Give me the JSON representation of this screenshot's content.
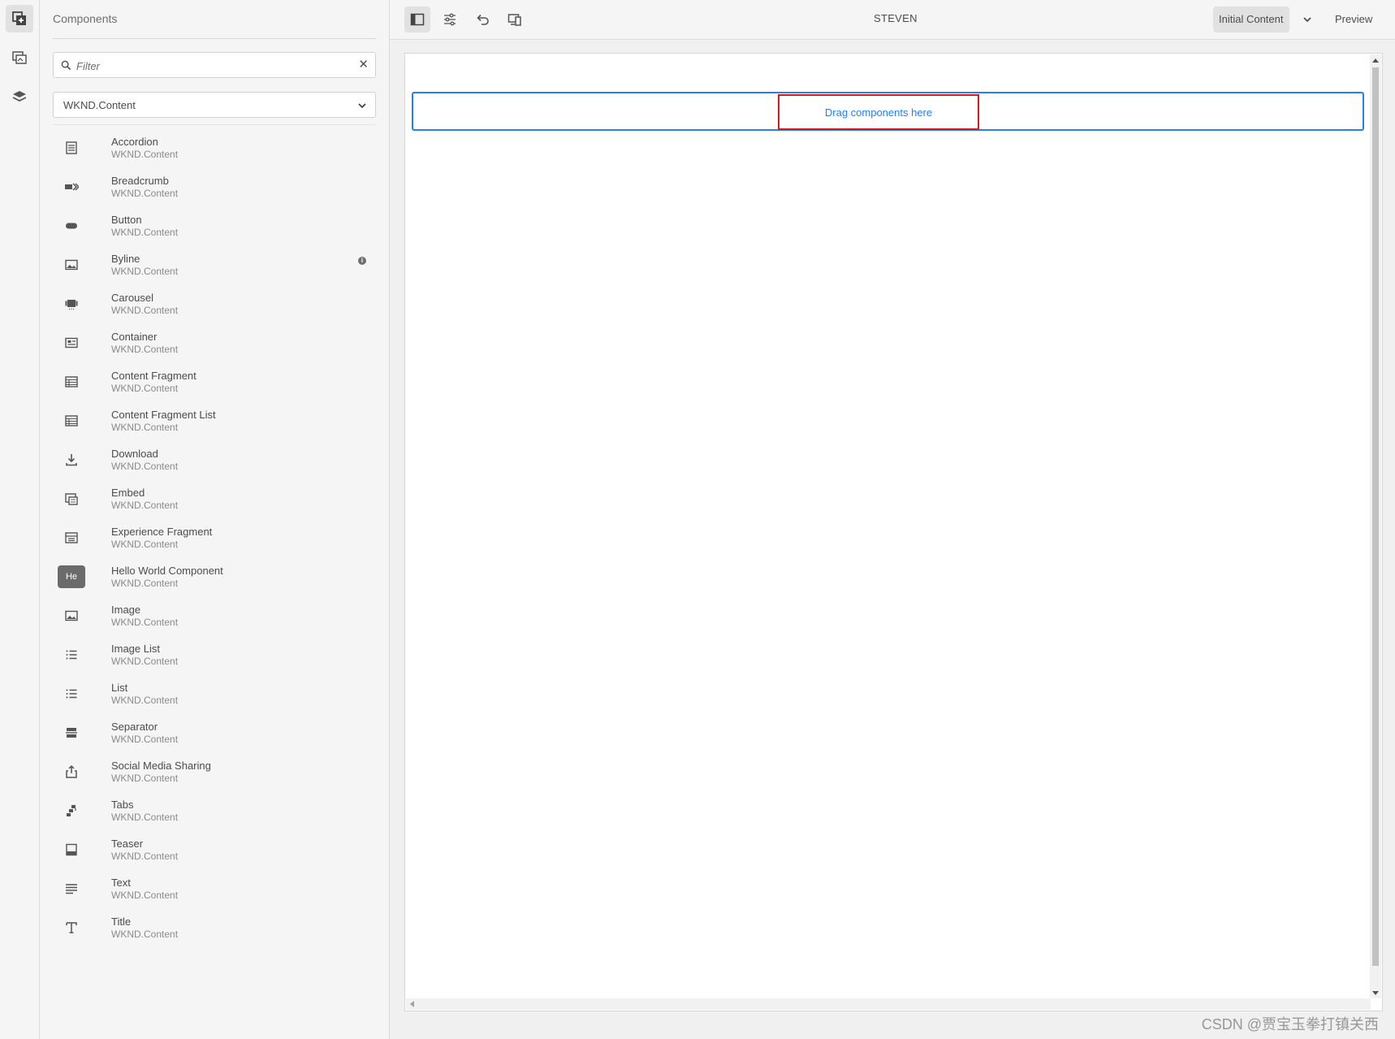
{
  "panel": {
    "title": "Components",
    "filter_placeholder": "Filter",
    "group_select": "WKND.Content",
    "components": [
      {
        "name": "Accordion",
        "group": "WKND.Content",
        "icon": "accordion-icon"
      },
      {
        "name": "Breadcrumb",
        "group": "WKND.Content",
        "icon": "breadcrumb-icon"
      },
      {
        "name": "Button",
        "group": "WKND.Content",
        "icon": "button-icon"
      },
      {
        "name": "Byline",
        "group": "WKND.Content",
        "icon": "image-icon",
        "info": "i"
      },
      {
        "name": "Carousel",
        "group": "WKND.Content",
        "icon": "carousel-icon"
      },
      {
        "name": "Container",
        "group": "WKND.Content",
        "icon": "container-icon"
      },
      {
        "name": "Content Fragment",
        "group": "WKND.Content",
        "icon": "table-icon"
      },
      {
        "name": "Content Fragment List",
        "group": "WKND.Content",
        "icon": "table-icon"
      },
      {
        "name": "Download",
        "group": "WKND.Content",
        "icon": "download-icon"
      },
      {
        "name": "Embed",
        "group": "WKND.Content",
        "icon": "embed-icon"
      },
      {
        "name": "Experience Fragment",
        "group": "WKND.Content",
        "icon": "fragment-icon"
      },
      {
        "name": "Hello World Component",
        "group": "WKND.Content",
        "icon": "text-badge",
        "badge": "He"
      },
      {
        "name": "Image",
        "group": "WKND.Content",
        "icon": "image-icon"
      },
      {
        "name": "Image List",
        "group": "WKND.Content",
        "icon": "list-icon"
      },
      {
        "name": "List",
        "group": "WKND.Content",
        "icon": "list-icon"
      },
      {
        "name": "Separator",
        "group": "WKND.Content",
        "icon": "separator-icon"
      },
      {
        "name": "Social Media Sharing",
        "group": "WKND.Content",
        "icon": "share-icon"
      },
      {
        "name": "Tabs",
        "group": "WKND.Content",
        "icon": "tabs-icon"
      },
      {
        "name": "Teaser",
        "group": "WKND.Content",
        "icon": "teaser-icon"
      },
      {
        "name": "Text",
        "group": "WKND.Content",
        "icon": "paragraph-icon"
      },
      {
        "name": "Title",
        "group": "WKND.Content",
        "icon": "title-icon"
      }
    ]
  },
  "toolbar": {
    "page_name": "STEVEN",
    "mode": "Initial Content",
    "preview": "Preview"
  },
  "canvas": {
    "drop_label": "Drag components here"
  },
  "watermark": "CSDN @贾宝玉拳打镇关西"
}
